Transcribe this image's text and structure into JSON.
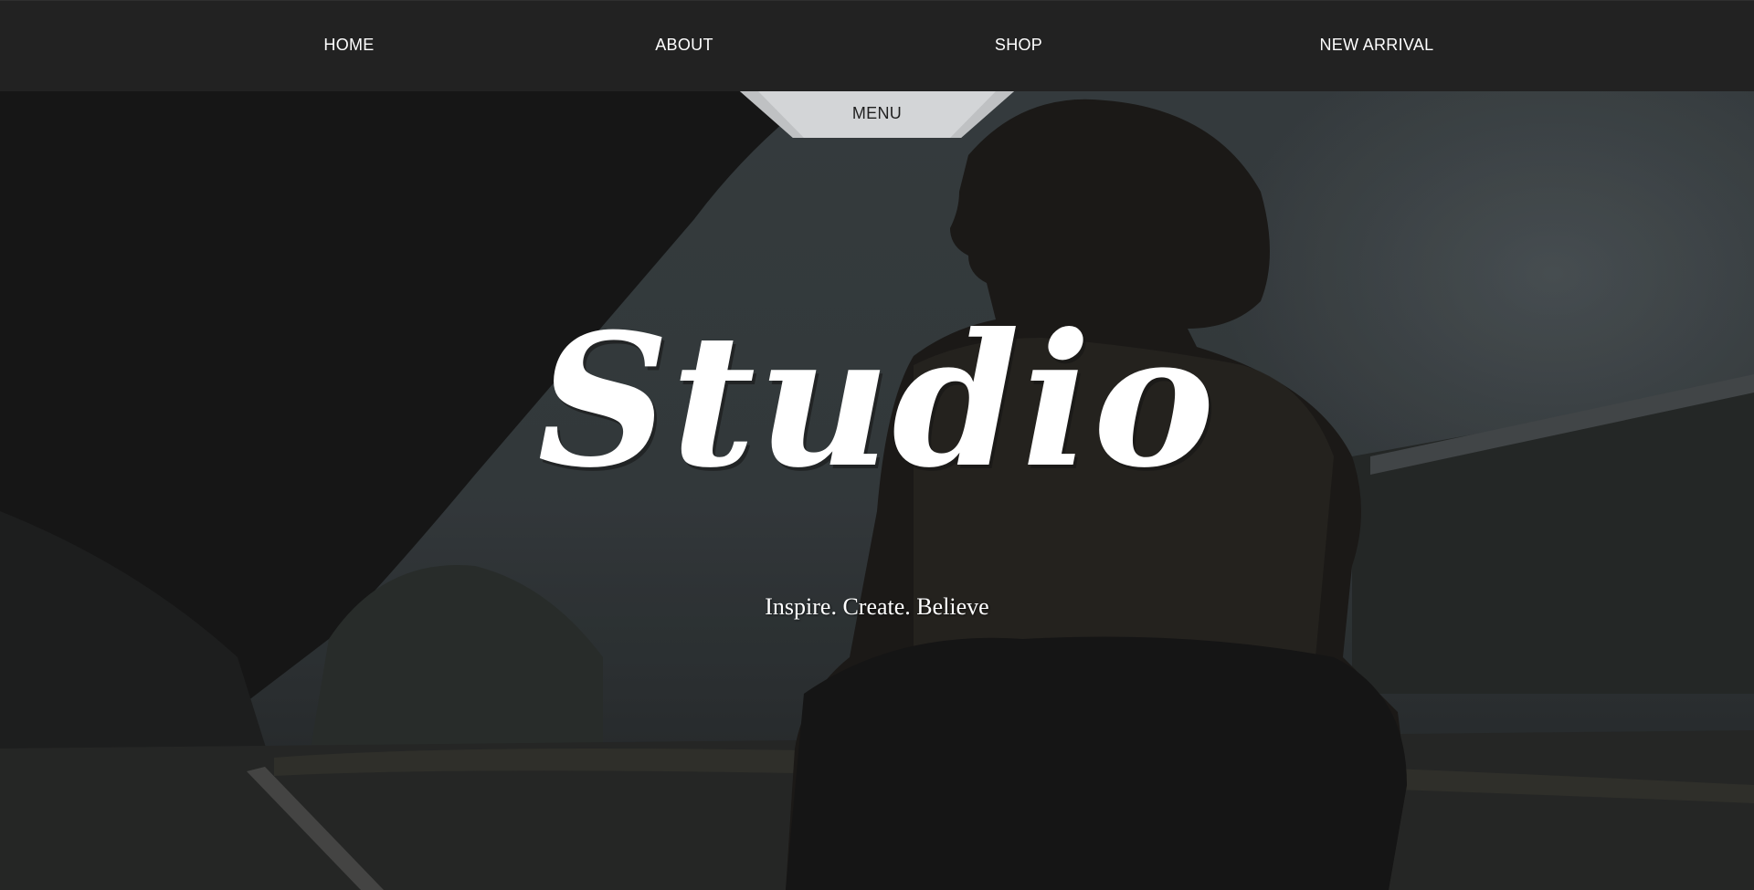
{
  "nav": {
    "items": [
      {
        "label": "HOME"
      },
      {
        "label": "ABOUT"
      },
      {
        "label": "SHOP"
      },
      {
        "label": "NEW ARRIVAL"
      }
    ],
    "menu_label": "MENU"
  },
  "hero": {
    "title": "Studio",
    "tagline": "Inspire. Create. Believe"
  },
  "colors": {
    "navbar_bg": "#222222",
    "menu_tab_bg": "#d3d5d7",
    "text": "#ffffff"
  }
}
